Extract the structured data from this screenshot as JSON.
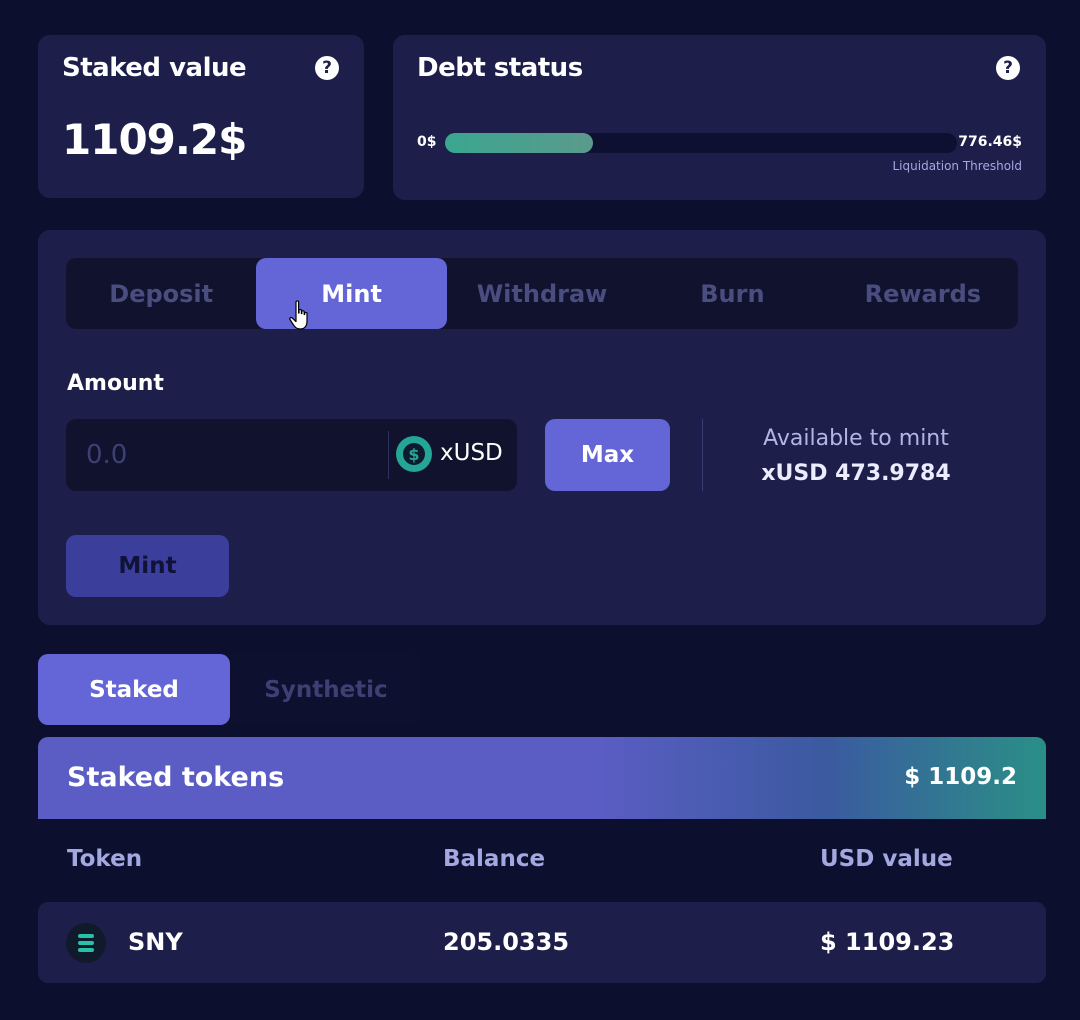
{
  "staked": {
    "title": "Staked value",
    "amount": "1109.2$",
    "help": "?"
  },
  "debt": {
    "title": "Debt status",
    "help": "?",
    "min_label": "0$",
    "max_label": "776.46$",
    "caption": "Liquidation Threshold",
    "fill_fraction": 0.29
  },
  "actions": {
    "tabs": [
      "Deposit",
      "Mint",
      "Withdraw",
      "Burn",
      "Rewards"
    ],
    "active_tab": "Mint",
    "amount_label": "Amount",
    "amount_placeholder": "0.0",
    "token_symbol": "xUSD",
    "token_icon": "dollar-coin-icon",
    "max_label": "Max",
    "available_label": "Available to mint",
    "available_value": "xUSD 473.9784",
    "submit_label": "Mint"
  },
  "asset_tabs": [
    "Staked",
    "Synthetic"
  ],
  "active_asset_tab": "Staked",
  "tokens": {
    "title": "Staked tokens",
    "total": "$ 1109.2",
    "columns": [
      "Token",
      "Balance",
      "USD value"
    ],
    "rows": [
      {
        "icon": "sny-token-icon",
        "token": "SNY",
        "balance": "205.0335",
        "usd": "$ 1109.23"
      }
    ]
  },
  "colors": {
    "accent": "#6466d8",
    "card": "#1d1f4a",
    "background": "#0c0f2e",
    "teal": "#25a596"
  }
}
